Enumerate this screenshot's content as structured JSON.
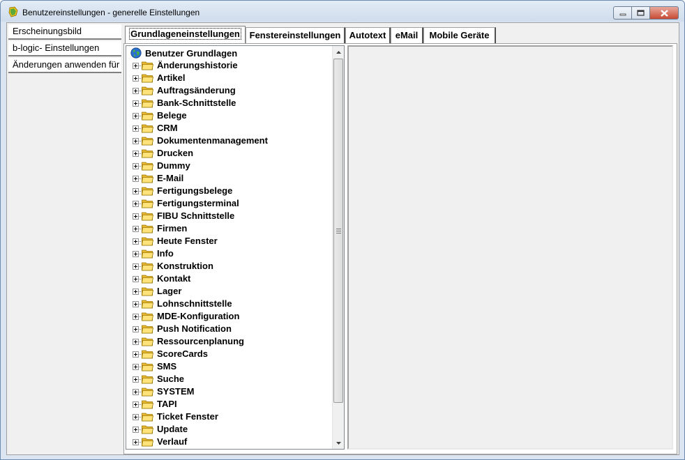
{
  "window": {
    "title": "Benutzereinstellungen - generelle Einstellungen",
    "accent_color": "#dbe5f1"
  },
  "left_nav": {
    "items": [
      {
        "label": "Erscheinungsbild"
      },
      {
        "label": "b-logic- Einstellungen"
      },
      {
        "label": "Änderungen anwenden für"
      }
    ]
  },
  "tabs": [
    {
      "label": "Grundlageneinstellungen",
      "active": true
    },
    {
      "label": "Fenstereinstellungen"
    },
    {
      "label": "Autotext"
    },
    {
      "label": "eMail"
    },
    {
      "label": "Mobile Geräte"
    }
  ],
  "tree": {
    "root": {
      "label": "Benutzer Grundlagen",
      "icon": "globe-icon"
    },
    "items": [
      {
        "label": "Änderungshistorie"
      },
      {
        "label": "Artikel"
      },
      {
        "label": "Auftragsänderung"
      },
      {
        "label": "Bank-Schnittstelle"
      },
      {
        "label": "Belege"
      },
      {
        "label": "CRM"
      },
      {
        "label": "Dokumentenmanagement"
      },
      {
        "label": "Drucken"
      },
      {
        "label": "Dummy"
      },
      {
        "label": "E-Mail"
      },
      {
        "label": "Fertigungsbelege"
      },
      {
        "label": "Fertigungsterminal"
      },
      {
        "label": "FIBU Schnittstelle"
      },
      {
        "label": "Firmen"
      },
      {
        "label": "Heute Fenster"
      },
      {
        "label": "Info"
      },
      {
        "label": "Konstruktion"
      },
      {
        "label": "Kontakt"
      },
      {
        "label": "Lager"
      },
      {
        "label": "Lohnschnittstelle"
      },
      {
        "label": "MDE-Konfiguration"
      },
      {
        "label": "Push Notification"
      },
      {
        "label": "Ressourcenplanung"
      },
      {
        "label": "ScoreCards"
      },
      {
        "label": "SMS"
      },
      {
        "label": "Suche"
      },
      {
        "label": "SYSTEM"
      },
      {
        "label": "TAPI"
      },
      {
        "label": "Ticket Fenster"
      },
      {
        "label": "Update"
      },
      {
        "label": "Verlauf"
      }
    ]
  }
}
